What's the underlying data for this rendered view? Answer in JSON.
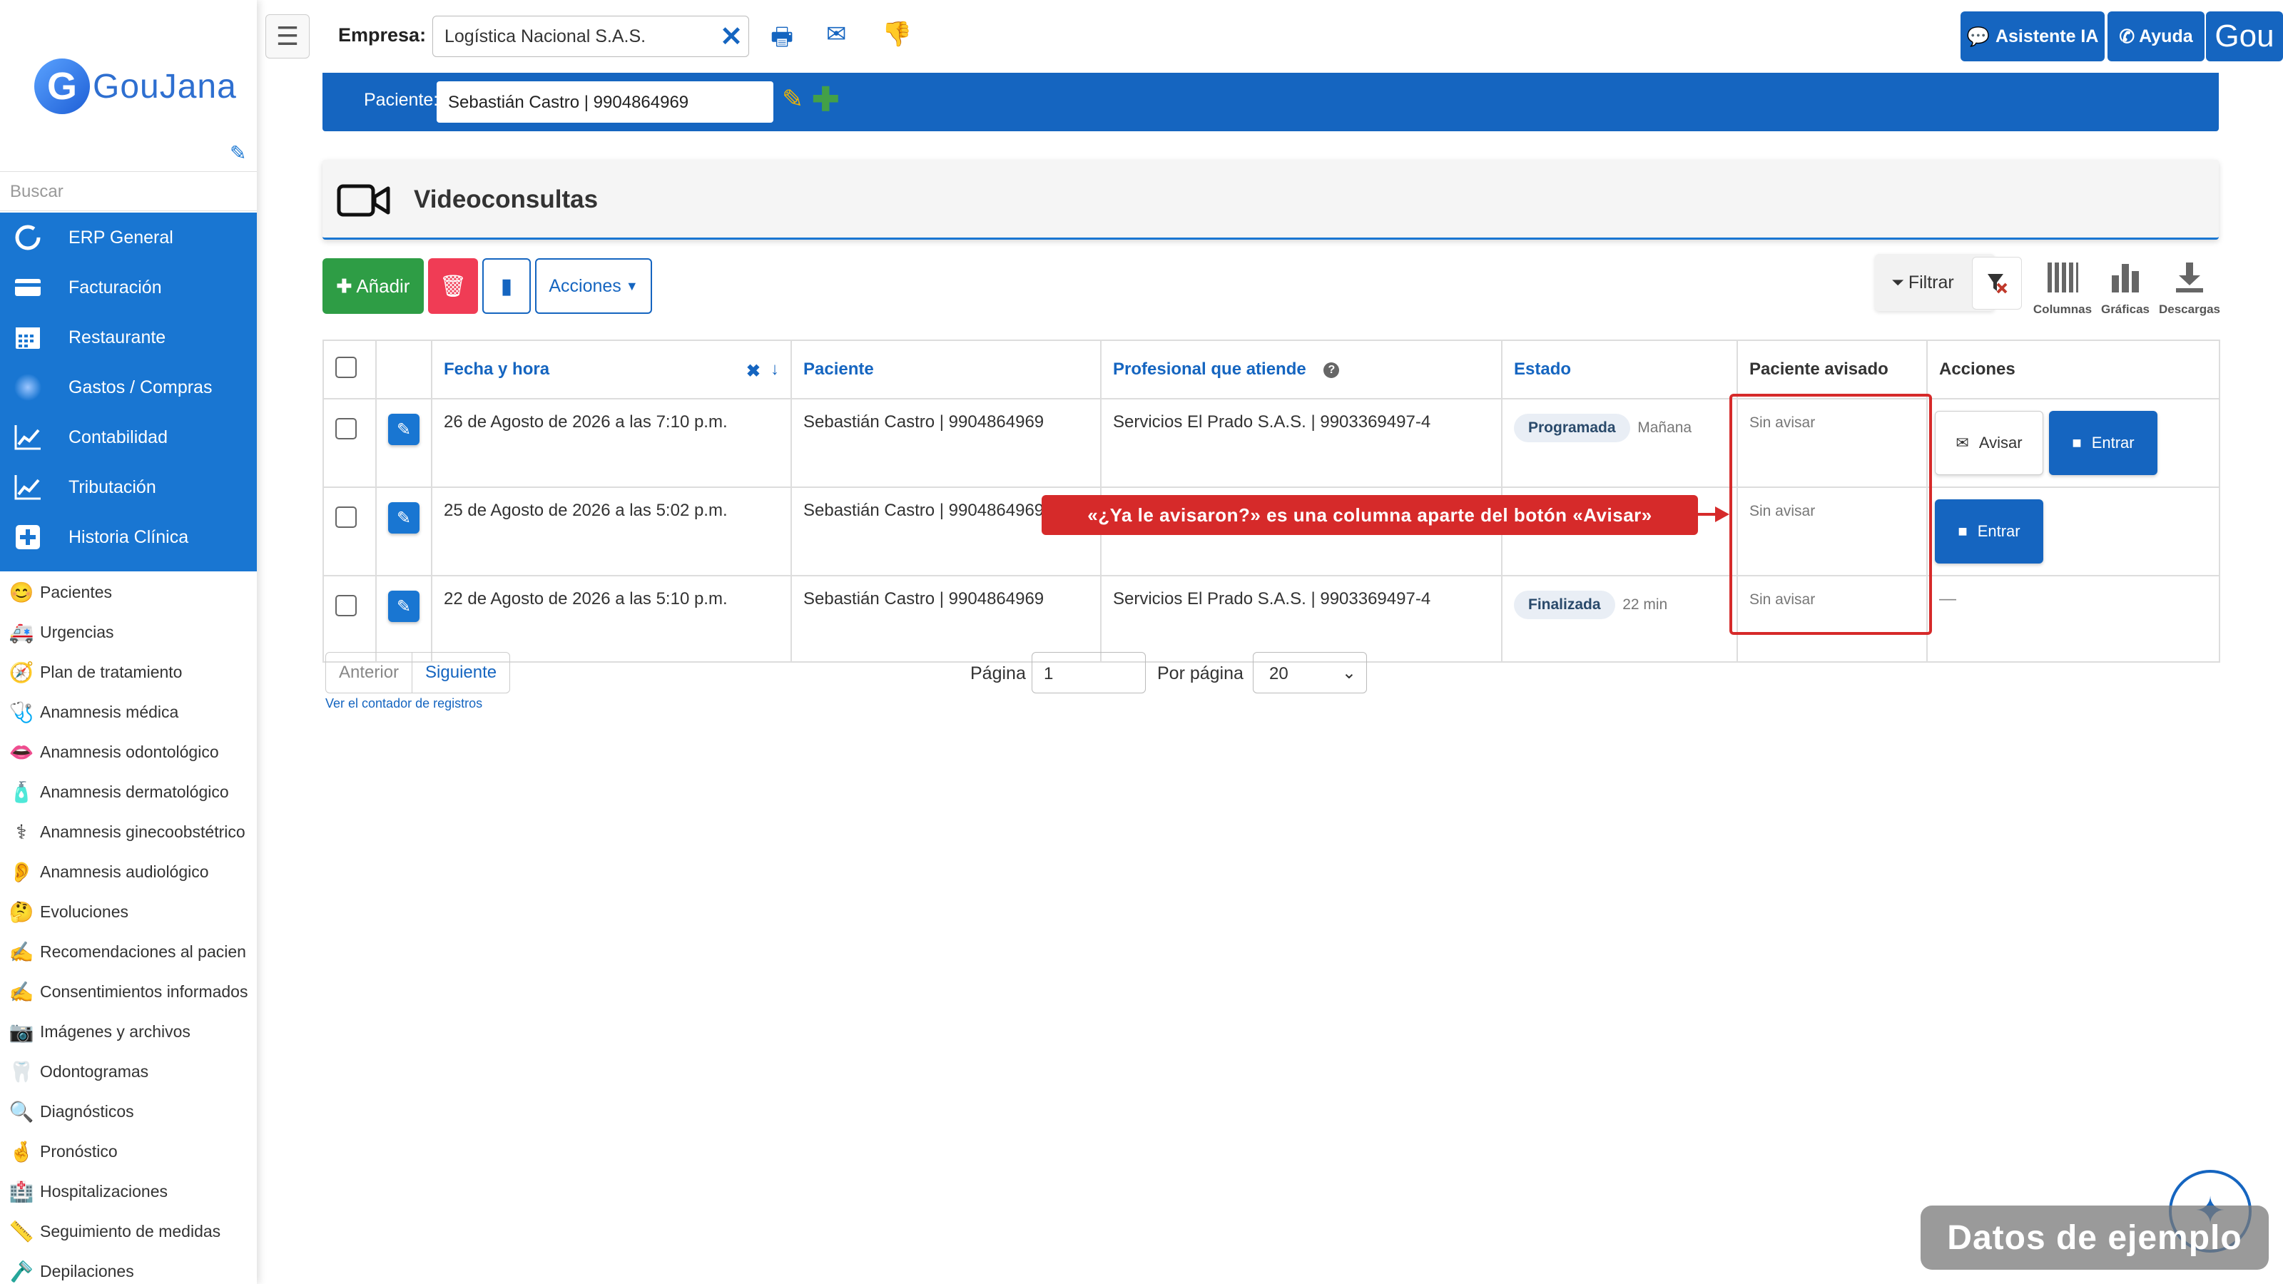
{
  "sidebar": {
    "logo_letter": "G",
    "logo_text": "GouJana",
    "search_placeholder": "Buscar",
    "blue_items": [
      {
        "label": "ERP General",
        "icon": "circle-icon"
      },
      {
        "label": "Facturación",
        "icon": "card-icon"
      },
      {
        "label": "Restaurante",
        "icon": "calendar-icon"
      },
      {
        "label": "Gastos / Compras",
        "icon": "blur-circle-icon"
      },
      {
        "label": "Contabilidad",
        "icon": "chart-line-icon"
      },
      {
        "label": "Tributación",
        "icon": "chart-line-icon"
      },
      {
        "label": "Historia Clínica",
        "icon": "plus-square-icon"
      }
    ],
    "items": [
      {
        "label": "Pacientes",
        "glyph": "😊"
      },
      {
        "label": "Urgencias",
        "glyph": "🚑"
      },
      {
        "label": "Plan de tratamiento",
        "glyph": "🧭"
      },
      {
        "label": "Anamnesis médica",
        "glyph": "🩺"
      },
      {
        "label": "Anamnesis odontológico",
        "glyph": "👄"
      },
      {
        "label": "Anamnesis dermatológico",
        "glyph": "🧴"
      },
      {
        "label": "Anamnesis ginecoobstétrico",
        "glyph": "⚕"
      },
      {
        "label": "Anamnesis audiológico",
        "glyph": "👂"
      },
      {
        "label": "Evoluciones",
        "glyph": "🤔"
      },
      {
        "label": "Recomendaciones al pacien",
        "glyph": "✍"
      },
      {
        "label": "Consentimientos informados",
        "glyph": "✍"
      },
      {
        "label": "Imágenes y archivos",
        "glyph": "📷"
      },
      {
        "label": "Odontogramas",
        "glyph": "🦷"
      },
      {
        "label": "Diagnósticos",
        "glyph": "🔍"
      },
      {
        "label": "Pronóstico",
        "glyph": "🤞"
      },
      {
        "label": "Hospitalizaciones",
        "glyph": "🏥"
      },
      {
        "label": "Seguimiento de medidas",
        "glyph": "📏"
      },
      {
        "label": "Depilaciones",
        "glyph": "🪒"
      }
    ]
  },
  "topbar": {
    "hamburger": "☰",
    "empresa_label": "Empresa:",
    "empresa_value": "Logística Nacional S.A.S.",
    "clear": "✕",
    "print": "🖶",
    "mail": "✉",
    "dislike": "👎",
    "ia_button": "Asistente IA",
    "help_button": "Ayuda",
    "gou": "Gou"
  },
  "patient": {
    "label": "Paciente:",
    "value": "Sebastián Castro | 9904864969",
    "edit": "✎",
    "add": "✚"
  },
  "header": {
    "title": "Videoconsultas"
  },
  "toolbar": {
    "add_label": "Añadir",
    "delete": "🗑",
    "book": "▮",
    "actions_label": "Acciones",
    "filter_label": "Filtrar",
    "clear_filter": "⌫",
    "columns_label": "Columnas",
    "charts_label": "Gráficas",
    "downloads_label": "Descargas"
  },
  "table": {
    "headers": {
      "date": "Fecha y hora",
      "patient": "Paciente",
      "professional": "Profesional que atiende",
      "status": "Estado",
      "notified": "Paciente avisado",
      "actions": "Acciones"
    },
    "rows": [
      {
        "date": "26 de Agosto de 2026 a las 7:10 p.m.",
        "patient": "Sebastián Castro | 9904864969",
        "professional": "Servicios El Prado S.A.S. | 9903369497-4",
        "status": "Programada",
        "status_note": "Mañana",
        "notified": "Sin avisar",
        "btn_avisar": "Avisar",
        "btn_entrar": "Entrar"
      },
      {
        "date": "25 de Agosto de 2026 a las 5:02 p.m.",
        "patient": "Sebastián Castro | 9904864969",
        "professional": "",
        "status": "",
        "status_note": "",
        "notified": "Sin avisar",
        "btn_entrar": "Entrar"
      },
      {
        "date": "22 de Agosto de 2026 a las 5:10 p.m.",
        "patient": "Sebastián Castro | 9904864969",
        "professional": "Servicios El Prado S.A.S. | 9903369497-4",
        "status": "Finalizada",
        "status_note": "22 min",
        "notified": "Sin avisar",
        "actions_text": "—"
      }
    ]
  },
  "callout": "«¿Ya le avisaron?» es una columna aparte del botón «Avisar»",
  "pagination": {
    "prev": "Anterior",
    "next": "Siguiente",
    "count_link": "Ver el contador de registros",
    "page_label": "Página",
    "page_value": "1",
    "per_page_label": "Por página",
    "per_page_value": "20"
  },
  "sample_badge": "Datos de ejemplo",
  "colors": {
    "primary": "#1565c0",
    "sidebar_blue": "#1976d2",
    "add_green": "#2e9d45",
    "delete_red": "#f03c55",
    "highlight_red": "#d62a2a"
  }
}
